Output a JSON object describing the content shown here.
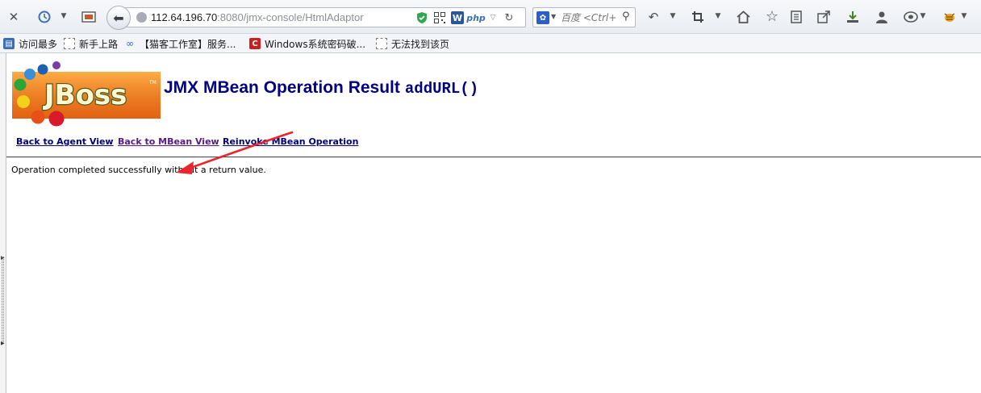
{
  "browser": {
    "url_host": "112.64.196.70",
    "url_rest": ":8080/jmx-console/HtmlAdaptor",
    "search_placeholder": "百度 <Ctrl+",
    "php_badge": "php",
    "word_badge": "W",
    "search_engine_glyph": "✿"
  },
  "bookmarks": [
    {
      "label": "访问最多",
      "icon": "bookmark-folder-icon"
    },
    {
      "label": "新手上路",
      "icon": "page-icon"
    },
    {
      "label": "【猫客工作室】服务...",
      "icon": "link-icon"
    },
    {
      "label": "Windows系统密码破...",
      "icon": "red-c-icon",
      "glyph": "C"
    },
    {
      "label": "无法找到该页",
      "icon": "page-icon"
    }
  ],
  "page": {
    "logo_text": "JBoss",
    "logo_tm": "TM",
    "title": "JMX MBean Operation Result",
    "operation": "addURL()",
    "links": {
      "agent": "Back to Agent View",
      "mbean": "Back to MBean View",
      "reinvoke": "Reinvoke MBean Operation"
    },
    "result_message": "Operation completed successfully without a return value."
  },
  "colors": {
    "title": "#000080",
    "visited_link": "#551a8b",
    "annotation_arrow": "#e8262c",
    "logo_orange": "#f07a1a"
  }
}
